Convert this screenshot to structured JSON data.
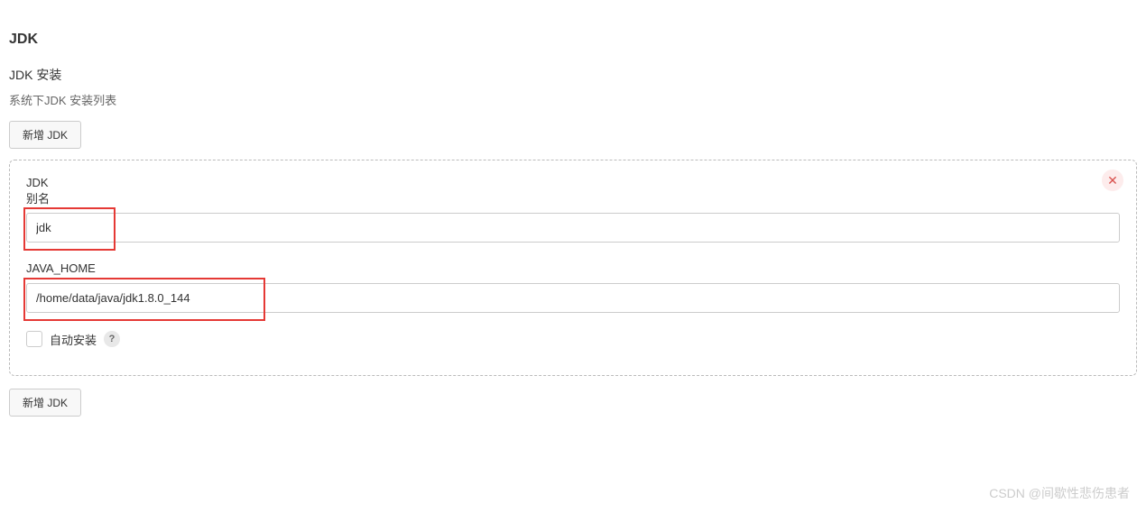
{
  "section": {
    "title": "JDK",
    "install_label": "JDK 安装",
    "install_list_label": "系统下JDK 安装列表",
    "add_button_top": "新增 JDK",
    "add_button_bottom": "新增 JDK"
  },
  "form": {
    "jdk_label_line1": "JDK",
    "jdk_label_line2": "别名",
    "jdk_alias_value": "jdk",
    "java_home_label": "JAVA_HOME",
    "java_home_value": "/home/data/java/jdk1.8.0_144",
    "auto_install_label": "自动安装",
    "auto_install_checked": false,
    "help_symbol": "?"
  },
  "icons": {
    "close": "✕"
  },
  "watermark": "CSDN @间歇性悲伤患者"
}
